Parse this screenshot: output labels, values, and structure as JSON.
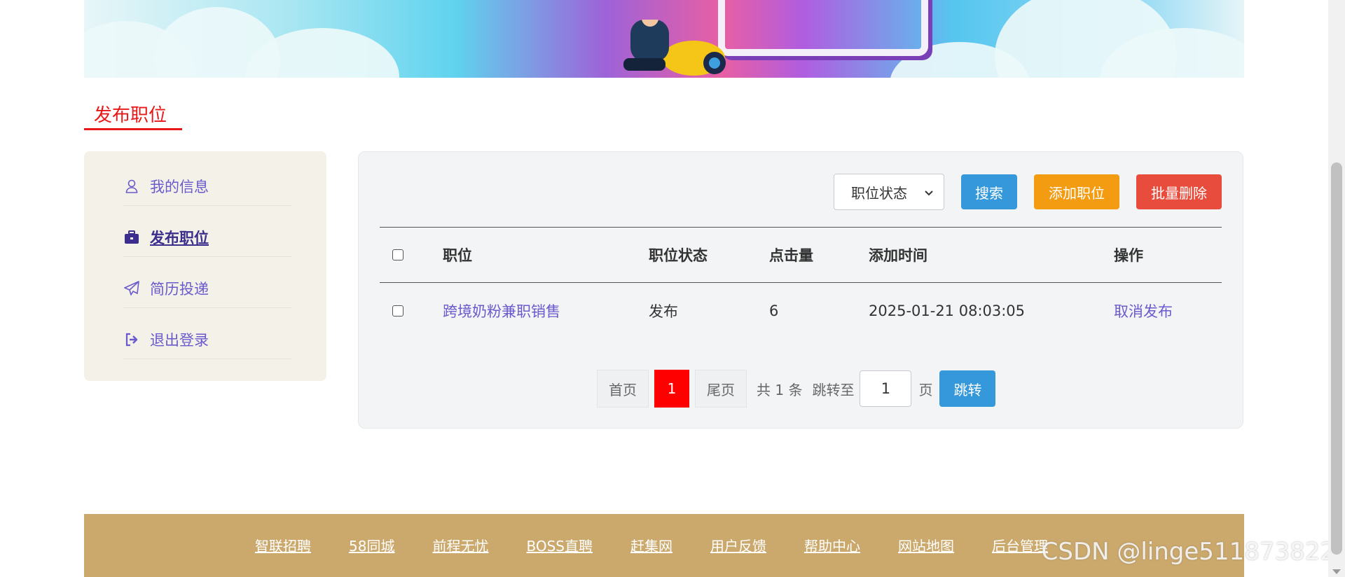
{
  "section_title": "发布职位",
  "sidebar": {
    "items": [
      {
        "label": "我的信息",
        "icon": "user-icon",
        "active": false
      },
      {
        "label": "发布职位",
        "icon": "briefcase-icon",
        "active": true
      },
      {
        "label": "简历投递",
        "icon": "paper-plane-icon",
        "active": false
      },
      {
        "label": "退出登录",
        "icon": "sign-out-icon",
        "active": false
      }
    ]
  },
  "toolbar": {
    "status_select_value": "职位状态",
    "search_label": "搜索",
    "add_label": "添加职位",
    "batch_delete_label": "批量删除"
  },
  "table": {
    "headers": [
      "职位",
      "职位状态",
      "点击量",
      "添加时间",
      "操作"
    ],
    "rows": [
      {
        "title": "跨境奶粉兼职销售",
        "status": "发布",
        "clicks": "6",
        "added": "2025-01-21 08:03:05",
        "action": "取消发布"
      }
    ]
  },
  "pagination": {
    "first_label": "首页",
    "current_page": "1",
    "last_label": "尾页",
    "total_text": "共 1 条",
    "jump_label": "跳转至",
    "jump_value": "1",
    "page_unit": "页",
    "go_label": "跳转"
  },
  "footer": {
    "links": [
      "智联招聘",
      "58同城",
      "前程无忧",
      "BOSS直聘",
      "赶集网",
      "用户反馈",
      "帮助中心",
      "网站地图",
      "后台管理"
    ]
  },
  "watermark": "CSDN @linge511873822",
  "colors": {
    "accent_red": "#e81818",
    "link_purple": "#6a5acd",
    "footer_bg": "#cba86b",
    "btn_blue": "#3498db",
    "btn_orange": "#f39c12",
    "btn_red": "#e74c3c"
  }
}
